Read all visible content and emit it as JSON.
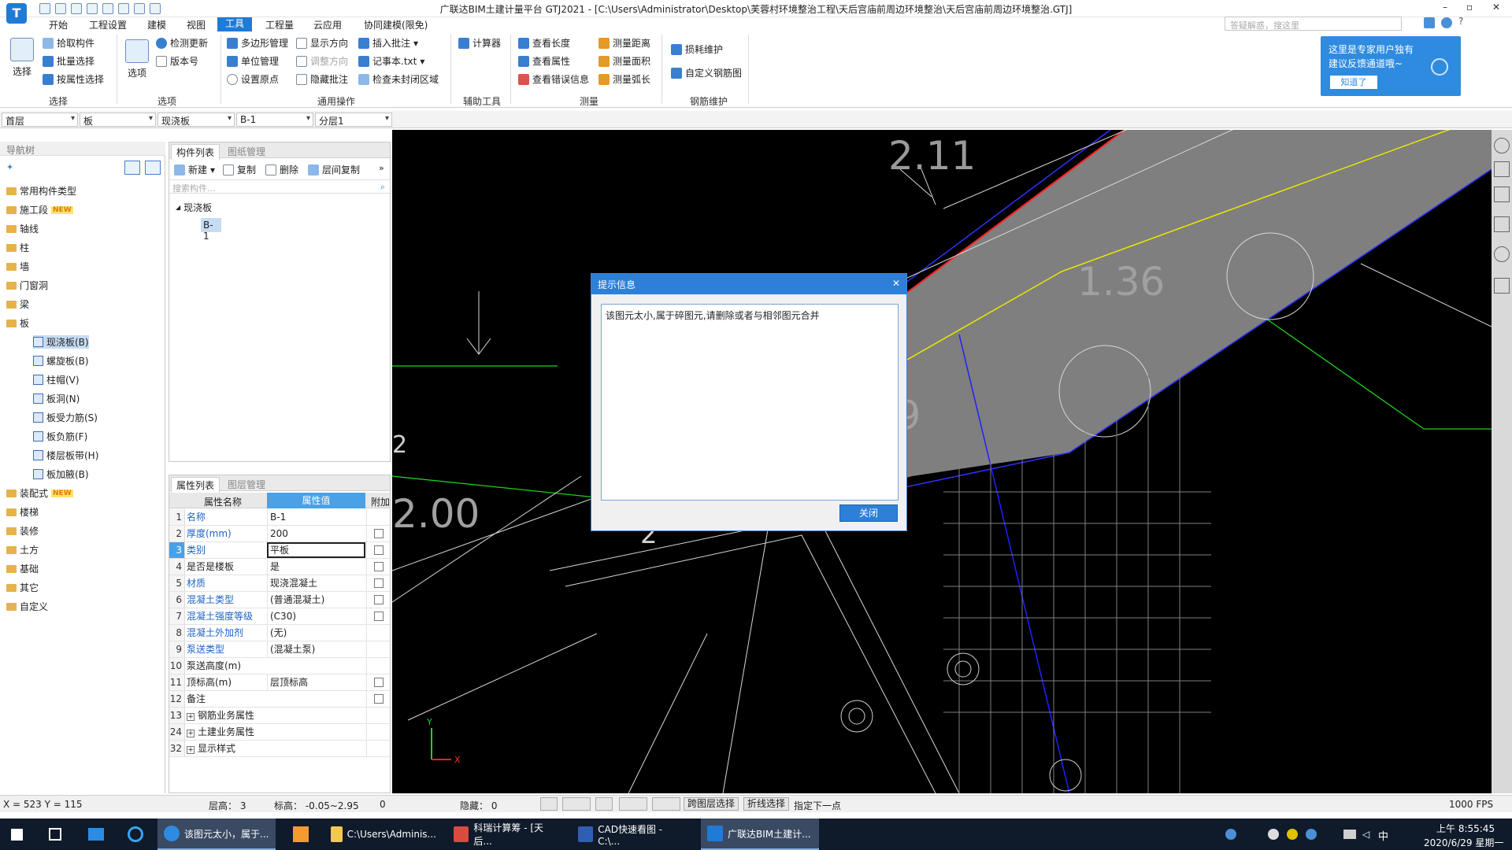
{
  "window": {
    "title": "广联达BIM土建计量平台 GTJ2021 - [C:\\Users\\Administrator\\Desktop\\芙蓉村环境整治工程\\天后宫庙前周边环境整治\\天后宫庙前周边环境整治.GTJ]",
    "controls": [
      "–",
      "▫",
      "✕"
    ]
  },
  "menu": {
    "items": [
      "开始",
      "工程设置",
      "建模",
      "视图",
      "工具",
      "工程量",
      "云应用",
      "协同建模(限免)"
    ],
    "active": "工具",
    "search_placeholder": "答疑解惑，搜这里"
  },
  "ribbon": {
    "groups": [
      {
        "label": "选择",
        "big": "选择",
        "items": [
          "拾取构件",
          "批量选择",
          "按属性选择"
        ]
      },
      {
        "label": "选项",
        "big": "选项",
        "items": [
          "检测更新",
          "版本号"
        ]
      },
      {
        "label": "通用操作",
        "items": [
          "多边形管理",
          "显示方向",
          "插入批注",
          "单位管理",
          "调整方向",
          "记事本.txt",
          "设置原点",
          "隐藏批注",
          "检查未封闭区域"
        ]
      },
      {
        "label": "辅助工具",
        "items": [
          "计算器"
        ]
      },
      {
        "label": "测量",
        "items": [
          "查看长度",
          "测量距离",
          "查看属性",
          "测量面积",
          "查看错误信息",
          "测量弧长"
        ]
      },
      {
        "label": "钢筋维护",
        "items": [
          "损耗维护",
          "自定义钢筋图"
        ]
      }
    ]
  },
  "tip": {
    "text1": "这里是专家用户独有",
    "text2": "建议反馈通道哦~",
    "button": "知道了"
  },
  "combos": [
    "首层",
    "板",
    "现浇板",
    "B-1",
    "分层1"
  ],
  "nav": {
    "header": "导航树",
    "items": [
      {
        "label": "常用构件类型",
        "new": false
      },
      {
        "label": "施工段",
        "new": true
      },
      {
        "label": "轴线",
        "new": false
      },
      {
        "label": "柱",
        "new": false
      },
      {
        "label": "墙",
        "new": false
      },
      {
        "label": "门窗洞",
        "new": false
      },
      {
        "label": "梁",
        "new": false
      },
      {
        "label": "板",
        "new": false
      }
    ],
    "sub_items": [
      "现浇板(B)",
      "螺旋板(B)",
      "柱帽(V)",
      "板洞(N)",
      "板受力筋(S)",
      "板负筋(F)",
      "楼层板带(H)",
      "板加腋(B)"
    ],
    "items_after": [
      {
        "label": "装配式",
        "new": true
      },
      {
        "label": "楼梯",
        "new": false
      },
      {
        "label": "装修",
        "new": false
      },
      {
        "label": "土方",
        "new": false
      },
      {
        "label": "基础",
        "new": false
      },
      {
        "label": "其它",
        "new": false
      },
      {
        "label": "自定义",
        "new": false
      }
    ],
    "new_tag": "NEW"
  },
  "components": {
    "tabs": [
      "构件列表",
      "图纸管理"
    ],
    "toolbar": [
      "新建",
      "复制",
      "删除",
      "层间复制"
    ],
    "search_placeholder": "搜索构件...",
    "tree_root": "现浇板",
    "tree_child": "B-1"
  },
  "properties": {
    "tabs": [
      "属性列表",
      "图层管理"
    ],
    "headers": [
      "属性名称",
      "属性值",
      "附加"
    ],
    "rows": [
      {
        "n": "1",
        "name": "名称",
        "value": "B-1",
        "link": true,
        "chk": false
      },
      {
        "n": "2",
        "name": "厚度(mm)",
        "value": "200",
        "link": true,
        "chk": true
      },
      {
        "n": "3",
        "name": "类别",
        "value": "平板",
        "link": true,
        "chk": true
      },
      {
        "n": "4",
        "name": "是否是楼板",
        "value": "是",
        "link": false,
        "chk": true
      },
      {
        "n": "5",
        "name": "材质",
        "value": "现浇混凝土",
        "link": true,
        "chk": true
      },
      {
        "n": "6",
        "name": "混凝土类型",
        "value": "(普通混凝土)",
        "link": true,
        "chk": true
      },
      {
        "n": "7",
        "name": "混凝土强度等级",
        "value": "(C30)",
        "link": true,
        "chk": true
      },
      {
        "n": "8",
        "name": "混凝土外加剂",
        "value": "(无)",
        "link": true,
        "chk": false
      },
      {
        "n": "9",
        "name": "泵送类型",
        "value": "(混凝土泵)",
        "link": true,
        "chk": false
      },
      {
        "n": "10",
        "name": "泵送高度(m)",
        "value": "",
        "link": false,
        "chk": false
      },
      {
        "n": "11",
        "name": "顶标高(m)",
        "value": "层顶标高",
        "link": false,
        "chk": true
      },
      {
        "n": "12",
        "name": "备注",
        "value": "",
        "link": false,
        "chk": true
      },
      {
        "n": "13",
        "name": "钢筋业务属性",
        "value": "",
        "link": false,
        "chk": false,
        "expand": true
      },
      {
        "n": "24",
        "name": "土建业务属性",
        "value": "",
        "link": false,
        "chk": false,
        "expand": true
      },
      {
        "n": "32",
        "name": "显示样式",
        "value": "",
        "link": false,
        "chk": false,
        "expand": true
      }
    ]
  },
  "canvas": {
    "texts": [
      "2.11",
      "1.36",
      "1.39",
      "3",
      "2",
      "2.00",
      "2"
    ]
  },
  "dialog": {
    "title": "提示信息",
    "message": "该图元太小,属于碎图元,请删除或者与相邻图元合并",
    "button": "关闭"
  },
  "status": {
    "coords": "X = 523 Y = 115",
    "floor_height": "层高：  3",
    "elevation": "标高：  -0.05~2.95",
    "zero": "0",
    "hidden": "隐藏：  0",
    "btn_layer": "跨图层选择",
    "btn_polyline": "折线选择",
    "hint": "指定下一点",
    "fps": "1000 FPS"
  },
  "taskbar": {
    "items": [
      "该图元太小，属于...",
      "C:\\Users\\Adminis...",
      "科瑞计算筹 - [天后...",
      "CAD快速看图 - C:\\...",
      "广联达BIM土建计..."
    ],
    "time": "上午 8:55:45",
    "date": "2020/6/29 星期一",
    "ime": "中"
  }
}
